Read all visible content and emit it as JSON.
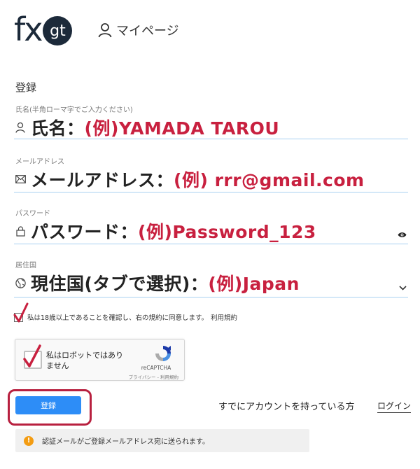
{
  "header": {
    "logo_fx": "fx",
    "logo_gt": "gt",
    "mypage_label": "マイページ"
  },
  "form": {
    "section_title": "登録",
    "name": {
      "small_label": "氏名(半角ローマ字でご入力ください)",
      "prefix": "氏名：",
      "example": "(例)YAMADA TAROU",
      "icon": "person-icon"
    },
    "email": {
      "small_label": "メールアドレス",
      "prefix": "メールアドレス：",
      "example": "(例) rrr@gmail.com",
      "icon": "mail-icon"
    },
    "password": {
      "small_label": "パスワード",
      "prefix": "パスワード：",
      "example": "(例)Password_123",
      "icon": "lock-icon",
      "trail_icon": "eye-icon"
    },
    "country": {
      "small_label": "居住国",
      "prefix": "現住国(タブで選択)：",
      "example": "(例)Japan",
      "icon": "globe-icon",
      "trail_icon": "chevron-down-icon"
    }
  },
  "terms": {
    "text": "私は18歳以上であることを確認し、右の規約に同意します。",
    "link": "利用規約"
  },
  "recaptcha": {
    "label": "私はロボットではありません",
    "brand": "reCAPTCHA",
    "links": "プライバシー - 利用規約"
  },
  "actions": {
    "submit_label": "登録",
    "account_text": "すでにアカウントを持っている方",
    "login_label": "ログイン"
  },
  "notice": {
    "text": "認証メールがご登録メールアドレス宛に送られます。"
  },
  "colors": {
    "accent_red": "#c8203f",
    "button_blue": "#2d8df7",
    "field_line": "#a8d0f0",
    "logo_dark": "#1c2a3a",
    "info_orange": "#f39c12"
  }
}
